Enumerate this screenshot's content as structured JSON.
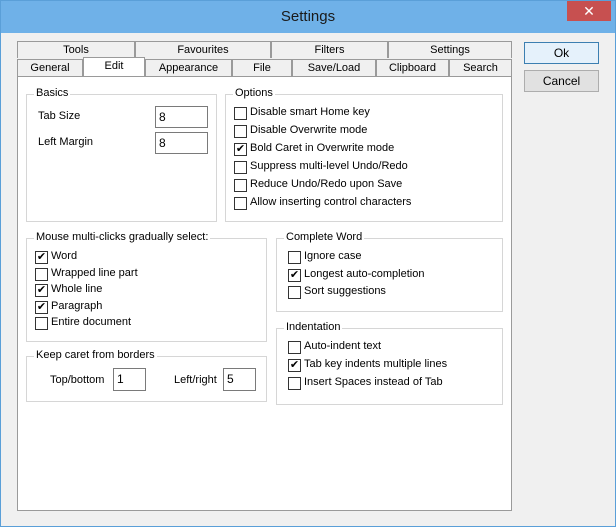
{
  "window": {
    "title": "Settings",
    "close_glyph": "✕"
  },
  "tabs_row1": [
    "Tools",
    "Favourites",
    "Filters",
    "Settings"
  ],
  "tabs_row2": [
    "General",
    "Edit",
    "Appearance",
    "File",
    "Save/Load",
    "Clipboard",
    "Search"
  ],
  "active_tab": "Edit",
  "basics": {
    "title": "Basics",
    "tab_size_label": "Tab Size",
    "tab_size_value": "8",
    "left_margin_label": "Left Margin",
    "left_margin_value": "8"
  },
  "options": {
    "title": "Options",
    "items": [
      {
        "label": "Disable smart Home key",
        "checked": false
      },
      {
        "label": "Disable Overwrite mode",
        "checked": false
      },
      {
        "label": "Bold Caret in Overwrite mode",
        "checked": true
      },
      {
        "label": "Suppress multi-level Undo/Redo",
        "checked": false
      },
      {
        "label": "Reduce Undo/Redo upon Save",
        "checked": false
      },
      {
        "label": "Allow inserting control characters",
        "checked": false
      }
    ]
  },
  "mouse": {
    "title": "Mouse multi-clicks gradually select:",
    "items": [
      {
        "label": "Word",
        "checked": true
      },
      {
        "label": "Wrapped line part",
        "checked": false
      },
      {
        "label": "Whole line",
        "checked": true
      },
      {
        "label": "Paragraph",
        "checked": true
      },
      {
        "label": "Entire document",
        "checked": false
      }
    ]
  },
  "caret": {
    "title": "Keep caret from borders",
    "top_bottom_label": "Top/bottom",
    "top_bottom_value": "1",
    "left_right_label": "Left/right",
    "left_right_value": "5"
  },
  "complete_word": {
    "title": "Complete Word",
    "items": [
      {
        "label": "Ignore case",
        "checked": false
      },
      {
        "label": "Longest auto-completion",
        "checked": true
      },
      {
        "label": "Sort suggestions",
        "checked": false
      }
    ]
  },
  "indentation": {
    "title": "Indentation",
    "items": [
      {
        "label": "Auto-indent text",
        "checked": false
      },
      {
        "label": "Tab key indents multiple lines",
        "checked": true
      },
      {
        "label": "Insert Spaces instead of Tab",
        "checked": false
      }
    ]
  },
  "buttons": {
    "ok": "Ok",
    "cancel": "Cancel"
  },
  "check_glyph": "✔"
}
